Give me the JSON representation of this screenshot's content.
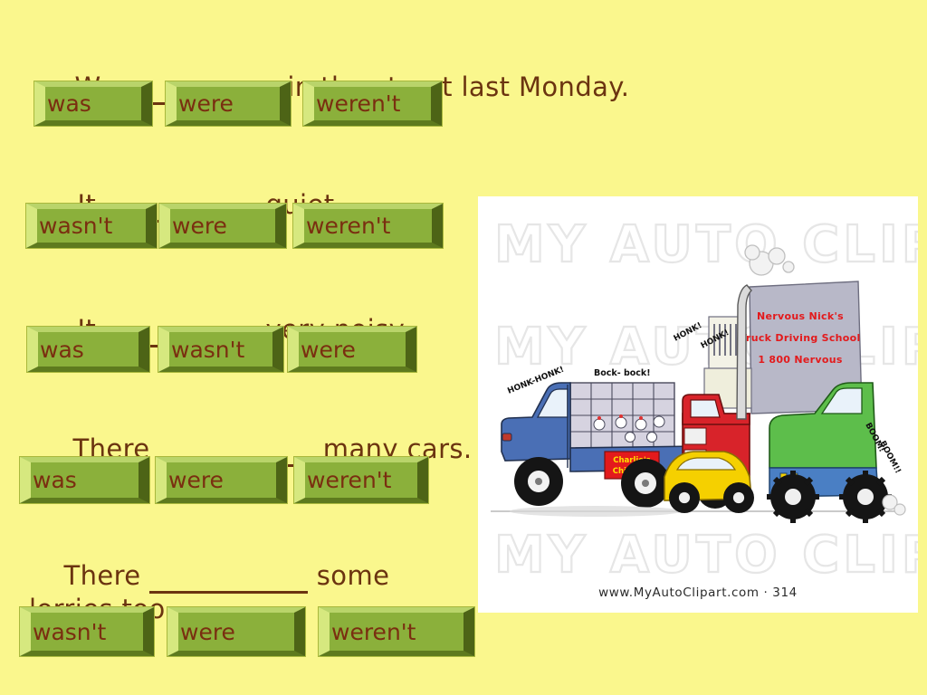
{
  "slide": {
    "background_color": "#FAF78D",
    "text_color": "#6B3410",
    "button_face_color": "#8BB03B",
    "button_label_color": "#7A2E10"
  },
  "exercises": [
    {
      "id": "q1",
      "prefix": "We ",
      "suffix": " in the street last Monday.",
      "options": [
        "was",
        "were",
        "weren't"
      ]
    },
    {
      "id": "q2",
      "prefix": "It ",
      "suffix": " quiet.",
      "options": [
        "wasn't",
        "were",
        "weren't"
      ]
    },
    {
      "id": "q3",
      "prefix": "It ",
      "suffix": " very noisy.",
      "options": [
        "was",
        "wasn't",
        "were"
      ]
    },
    {
      "id": "q4",
      "prefix": "There ",
      "suffix": " many cars.",
      "options": [
        "was",
        "were",
        "weren't"
      ]
    },
    {
      "id": "q5",
      "prefix": "There ",
      "suffix": " some\nlorries,too.",
      "options": [
        "wasn't",
        "were",
        "weren't"
      ]
    }
  ],
  "clipart": {
    "watermark": "MY AUTO CLIPART",
    "credit": "www.MyAutoClipart.com  ·  314",
    "sign": {
      "line1": "Nervous Nick's",
      "line2": "Truck Driving School",
      "line3": "1 800 Nervous",
      "color": "#E31A1C"
    },
    "sounds": {
      "honk_long": "HONK-HONK!",
      "bock": "Bock- bock!",
      "honk1": "HONK!",
      "honk2": "HONK!",
      "boom1": "BOOM!",
      "boom2": "BOOM!!"
    },
    "truck_sign": {
      "line1": "Charlie's",
      "line2": "Chickens"
    },
    "vehicle_colors": {
      "pickup": "#4A6FB5",
      "semi": "#D8232A",
      "car": "#F5D000",
      "monster_truck": "#5DBE4B",
      "building": "#B8B8C8"
    }
  }
}
